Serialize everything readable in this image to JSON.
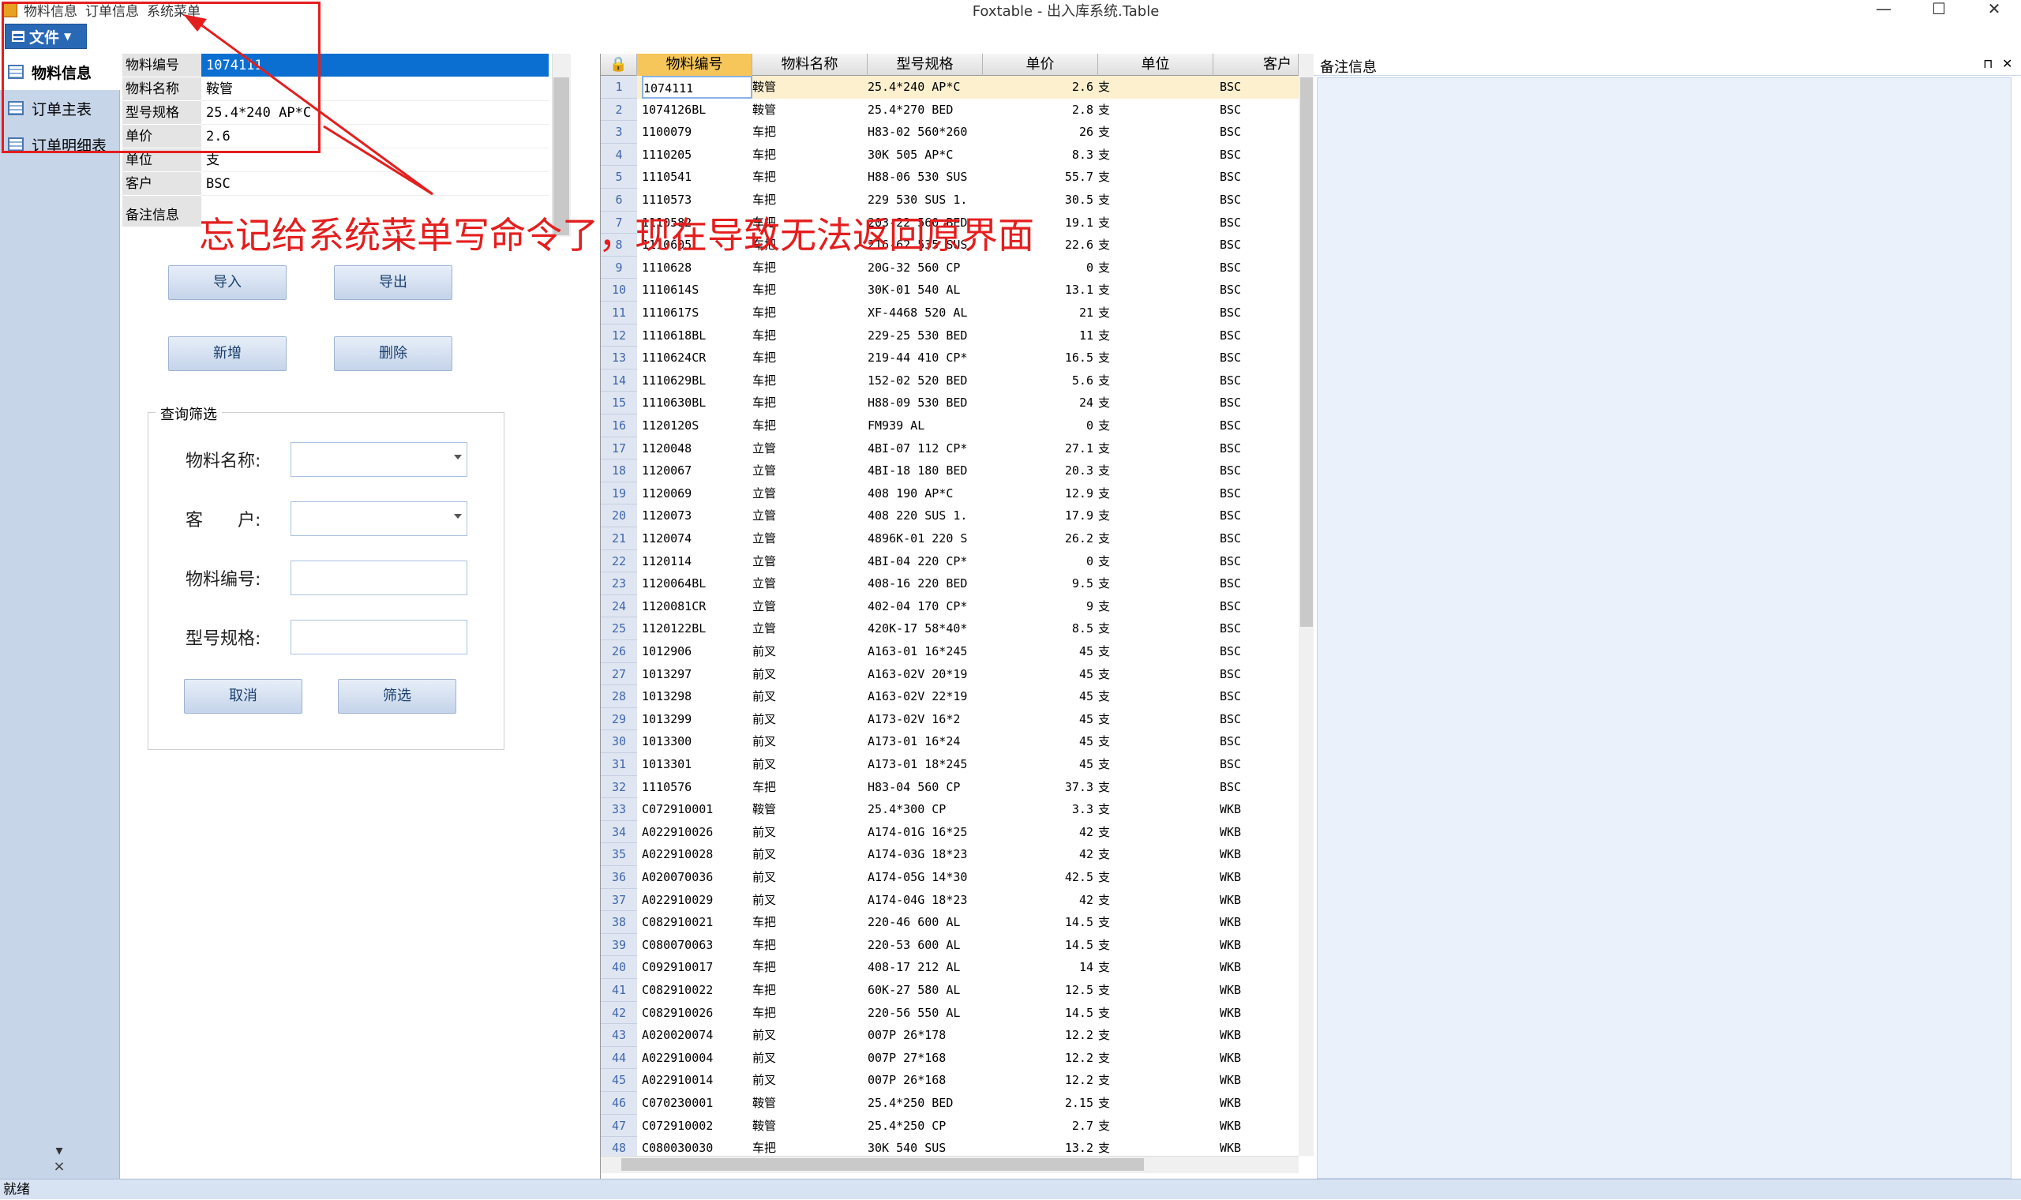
{
  "window": {
    "title": "Foxtable - 出入库系统.Table",
    "minimize": "—",
    "maximize": "☐",
    "close": "✕"
  },
  "quick_access": [
    "物料信息",
    "订单信息",
    "系统菜单"
  ],
  "ribbon": {
    "file_label": "文件"
  },
  "nav": {
    "items": [
      {
        "label": "物料信息",
        "active": true
      },
      {
        "label": "订单主表",
        "active": false
      },
      {
        "label": "订单明细表",
        "active": false
      }
    ],
    "footer": [
      "▾",
      "×"
    ]
  },
  "detail": {
    "fields": [
      {
        "label": "物料编号",
        "value": "1074111"
      },
      {
        "label": "物料名称",
        "value": "鞍管"
      },
      {
        "label": "型号规格",
        "value": "25.4*240 AP*C"
      },
      {
        "label": "单价",
        "value": "2.6"
      },
      {
        "label": "单位",
        "value": "支"
      },
      {
        "label": "客户",
        "value": "BSC"
      },
      {
        "label": "备注信息",
        "value": ""
      }
    ],
    "buttons": {
      "import": "导入",
      "export": "导出",
      "add": "新增",
      "delete": "删除",
      "cancel": "取消",
      "filter": "筛选"
    },
    "filter": {
      "title": "查询筛选",
      "name_label": "物料名称:",
      "customer_label": "客　　户:",
      "code_label": "物料编号:",
      "spec_label": "型号规格:"
    }
  },
  "grid": {
    "columns": [
      "物料编号",
      "物料名称",
      "型号规格",
      "单价",
      "单位",
      "客户"
    ],
    "rows": [
      [
        "1074111",
        "鞍管",
        "25.4*240 AP*C",
        "2.6",
        "支",
        "BSC"
      ],
      [
        "1074126BL",
        "鞍管",
        "25.4*270 BED",
        "2.8",
        "支",
        "BSC"
      ],
      [
        "1100079",
        "车把",
        "H83-02 560*260",
        "26",
        "支",
        "BSC"
      ],
      [
        "1110205",
        "车把",
        "30K 505 AP*C",
        "8.3",
        "支",
        "BSC"
      ],
      [
        "1110541",
        "车把",
        "H88-06 530 SUS",
        "55.7",
        "支",
        "BSC"
      ],
      [
        "1110573",
        "车把",
        "229 530 SUS 1.",
        "30.5",
        "支",
        "BSC"
      ],
      [
        "1110582",
        "车把",
        "203-22 560 BED",
        "19.1",
        "支",
        "BSC"
      ],
      [
        "1110605",
        "车把",
        "216-62 535 SUS",
        "22.6",
        "支",
        "BSC"
      ],
      [
        "1110628",
        "车把",
        "20G-32 560 CP",
        "0",
        "支",
        "BSC"
      ],
      [
        "1110614S",
        "车把",
        "30K-01 540 AL",
        "13.1",
        "支",
        "BSC"
      ],
      [
        "1110617S",
        "车把",
        "XF-4468 520 AL",
        "21",
        "支",
        "BSC"
      ],
      [
        "1110618BL",
        "车把",
        "229-25 530 BED",
        "11",
        "支",
        "BSC"
      ],
      [
        "1110624CR",
        "车把",
        "219-44 410 CP*",
        "16.5",
        "支",
        "BSC"
      ],
      [
        "1110629BL",
        "车把",
        "152-02 520 BED",
        "5.6",
        "支",
        "BSC"
      ],
      [
        "1110630BL",
        "车把",
        "H88-09 530 BED",
        "24",
        "支",
        "BSC"
      ],
      [
        "1120120S",
        "车把",
        "FM939 AL",
        "0",
        "支",
        "BSC"
      ],
      [
        "1120048",
        "立管",
        "4BI-07 112 CP*",
        "27.1",
        "支",
        "BSC"
      ],
      [
        "1120067",
        "立管",
        "4BI-18 180 BED",
        "20.3",
        "支",
        "BSC"
      ],
      [
        "1120069",
        "立管",
        "408 190 AP*C",
        "12.9",
        "支",
        "BSC"
      ],
      [
        "1120073",
        "立管",
        "408 220 SUS 1.",
        "17.9",
        "支",
        "BSC"
      ],
      [
        "1120074",
        "立管",
        "4896K-01 220 S",
        "26.2",
        "支",
        "BSC"
      ],
      [
        "1120114",
        "立管",
        "4BI-04 220 CP*",
        "0",
        "支",
        "BSC"
      ],
      [
        "1120064BL",
        "立管",
        "408-16 220 BED",
        "9.5",
        "支",
        "BSC"
      ],
      [
        "1120081CR",
        "立管",
        "402-04 170 CP*",
        "9",
        "支",
        "BSC"
      ],
      [
        "1120122BL",
        "立管",
        "420K-17 58*40*",
        "8.5",
        "支",
        "BSC"
      ],
      [
        "1012906",
        "前叉",
        "A163-01 16*245",
        "45",
        "支",
        "BSC"
      ],
      [
        "1013297",
        "前叉",
        "A163-02V 20*19",
        "45",
        "支",
        "BSC"
      ],
      [
        "1013298",
        "前叉",
        "A163-02V 22*19",
        "45",
        "支",
        "BSC"
      ],
      [
        "1013299",
        "前叉",
        "A173-02V  16*2",
        "45",
        "支",
        "BSC"
      ],
      [
        "1013300",
        "前叉",
        "A173-01   16*24",
        "45",
        "支",
        "BSC"
      ],
      [
        "1013301",
        "前叉",
        "A173-01 18*245",
        "45",
        "支",
        "BSC"
      ],
      [
        "1110576",
        "车把",
        "H83-04 560 CP",
        "37.3",
        "支",
        "BSC"
      ],
      [
        "C072910001",
        "鞍管",
        "25.4*300 CP",
        "3.3",
        "支",
        "WKB"
      ],
      [
        "A022910026",
        "前叉",
        "A174-01G 16*25",
        "42",
        "支",
        "WKB"
      ],
      [
        "A022910028",
        "前叉",
        "A174-03G 18*23",
        "42",
        "支",
        "WKB"
      ],
      [
        "A020070036",
        "前叉",
        "A174-05G 14*30",
        "42.5",
        "支",
        "WKB"
      ],
      [
        "A022910029",
        "前叉",
        "A174-04G 18*23",
        "42",
        "支",
        "WKB"
      ],
      [
        "C082910021",
        "车把",
        "220-46 600 AL",
        "14.5",
        "支",
        "WKB"
      ],
      [
        "C080070063",
        "车把",
        "220-53 600 AL",
        "14.5",
        "支",
        "WKB"
      ],
      [
        "C092910017",
        "车把",
        "408-17 212 AL",
        "14",
        "支",
        "WKB"
      ],
      [
        "C082910022",
        "车把",
        "60K-27 580 AL",
        "12.5",
        "支",
        "WKB"
      ],
      [
        "C082910026",
        "车把",
        "220-56 550 AL",
        "14.5",
        "支",
        "WKB"
      ],
      [
        "A020020074",
        "前叉",
        "007P 26*178",
        "12.2",
        "支",
        "WKB"
      ],
      [
        "A022910004",
        "前叉",
        "007P 27*168",
        "12.2",
        "支",
        "WKB"
      ],
      [
        "A022910014",
        "前叉",
        "007P 26*168",
        "12.2",
        "支",
        "WKB"
      ],
      [
        "C070230001",
        "鞍管",
        "25.4*250 BED",
        "2.15",
        "支",
        "WKB"
      ],
      [
        "C072910002",
        "鞍管",
        "25.4*250 CP",
        "2.7",
        "支",
        "WKB"
      ],
      [
        "C080030030",
        "车把",
        "30K 540 SUS",
        "13.2",
        "支",
        "WKB"
      ]
    ]
  },
  "remarks": {
    "title": "备注信息",
    "pin": "⊓",
    "close": "✕"
  },
  "status": {
    "text": "就绪"
  },
  "annotation": {
    "text": "忘记给系统菜单写命令了，现在导致无法返回原界面"
  }
}
